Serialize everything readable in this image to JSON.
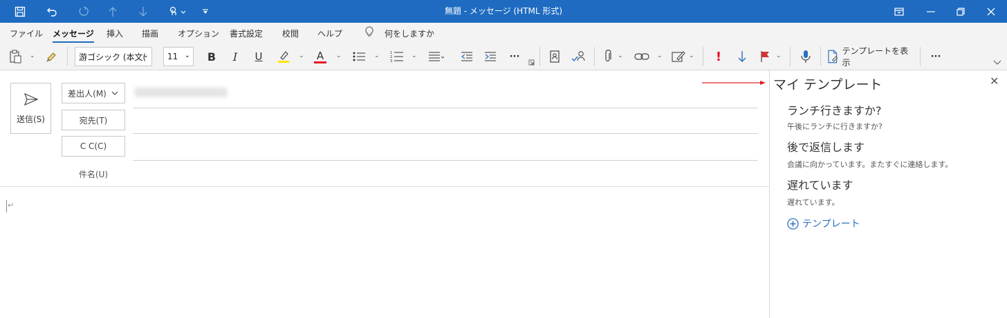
{
  "window": {
    "title": "無題 - メッセージ (HTML 形式)"
  },
  "quick_access": {
    "icons": [
      "save-icon",
      "undo-icon",
      "redo-icon",
      "up-arrow-icon",
      "down-arrow-icon",
      "touch-mode-icon",
      "customize-icon"
    ]
  },
  "menu": {
    "tabs": [
      "ファイル",
      "メッセージ",
      "挿入",
      "描画",
      "オプション",
      "書式設定",
      "校閲",
      "ヘルプ"
    ],
    "active_tab": "メッセージ",
    "tell_me": "何をしますか"
  },
  "ribbon": {
    "font_name": "游ゴシック (本文(",
    "font_size": "11",
    "bold": "B",
    "italic": "I",
    "underline": "U",
    "font_color_letter": "A",
    "more": "···",
    "importance_high": "!",
    "show_templates": "テンプレートを表示",
    "overflow": "···"
  },
  "compose": {
    "send_label": "送信(S)",
    "from_label": "差出人(M)",
    "to_label": "宛先(T)",
    "cc_label": "C C(C)",
    "subject_label": "件名(U)",
    "paragraph_mark": "↵"
  },
  "templates_pane": {
    "title": "マイ テンプレート",
    "items": [
      {
        "title": "ランチ行きますか?",
        "body": "午後にランチに行きますか?"
      },
      {
        "title": "後で返信します",
        "body": "会議に向かっています。またすぐに連絡します。"
      },
      {
        "title": "遅れています",
        "body": "遅れています。"
      }
    ],
    "add_label": "テンプレート"
  },
  "colors": {
    "title_bar": "#1e6bc1",
    "annotation_arrow": "#e02020",
    "highlight": "#ffe500",
    "font_color": "#e81123",
    "flag": "#d13438",
    "accent": "#2b6fc2"
  }
}
